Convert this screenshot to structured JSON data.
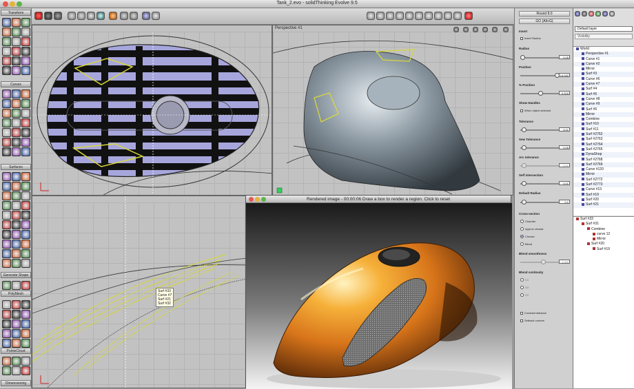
{
  "window": {
    "title": "Tank_2.evo - solidThinking Evolve 9.5"
  },
  "palette": {
    "sections": [
      "Transform",
      "Curves",
      "Surfaces",
      "Generate Shape",
      "PolyMesh",
      "PointsCloud",
      "Dimensioning"
    ]
  },
  "viewports": {
    "top_left_label": "",
    "persp_label": "Perspective #1",
    "bottom_left_label": ""
  },
  "tooltip": {
    "lines": [
      "Surf #33",
      "Curve #7",
      "Surf #21",
      "Surf #32"
    ]
  },
  "render_window": {
    "title": "Rendered image - 00:00:06 Draw a box to render a region. Click to reset"
  },
  "properties": {
    "title": "Round 8.0",
    "go_button": "GO (Alt+G)",
    "insert_label": "Insert",
    "insert_radius": "Insert Radius",
    "radius_label": "Radius",
    "radius_value": "0.05",
    "position_label": "Position",
    "position_value": "14.042",
    "pct_position_label": "% Position",
    "pct_position_value": "0.516",
    "show_handles_label": "Show Handles",
    "when_selected": "When object selected",
    "tolerance_label": "Tolerance",
    "tolerance_value": "0.01",
    "sew_tolerance_label": "Sew Tolerance",
    "sew_tolerance_value": "0.05",
    "arc_tolerance_label": "Arc tolerance",
    "arc_tolerance_value": "0.01",
    "self_intersection_label": "Self intersection",
    "self_intersection_value": "0.01",
    "default_radius_label": "Default Radius",
    "default_radius_value": "0.1",
    "cross_section_label": "Cross-section",
    "cross_options": [
      "Chamfer",
      "Approx circular",
      "Circular",
      "Blend"
    ],
    "cross_selected": "Circular",
    "blend_smoothness_label": "Blend smoothness",
    "blend_smoothness_value": "1.000",
    "blend_continuity_label": "Blend continuity",
    "continuity_options": [
      "C1",
      "G2",
      "C2"
    ],
    "constant_distance": "Constant distance",
    "setback_corners": "Setback corners"
  },
  "browser": {
    "layer": "Default layer",
    "visibility": "Visibility",
    "tree": [
      "World",
      "Perspective #1",
      "Curve #1",
      "Curve #2",
      "Mirror",
      "Surf #3",
      "Curve #6",
      "Curve #7",
      "Surf #4",
      "Surf #5",
      "Curve #8",
      "Curve #9",
      "Surf #6",
      "Mirror",
      "Combine",
      "Surf #10",
      "Surf #11",
      "Surf #2762",
      "Surf #2763",
      "Surf #2764",
      "Surf #2765",
      "DynaShop",
      "Surf #2768",
      "Surf #2769",
      "Curve #120",
      "Mirror",
      "Surf #2772",
      "Surf #2773",
      "Curve #13",
      "Surf #19",
      "Surf #20",
      "Surf #21"
    ],
    "tree2": [
      "Surf #33",
      "Surf #31",
      "Combine",
      "curve 12",
      "Mirror",
      "Surf #20",
      "Surf #19"
    ]
  },
  "colors": {
    "accent_blue": "#3a5ea8",
    "body_orange": "#e88a1a",
    "stripe_purple": "#a7a6dc",
    "yellow_curve": "#d8d83a"
  }
}
